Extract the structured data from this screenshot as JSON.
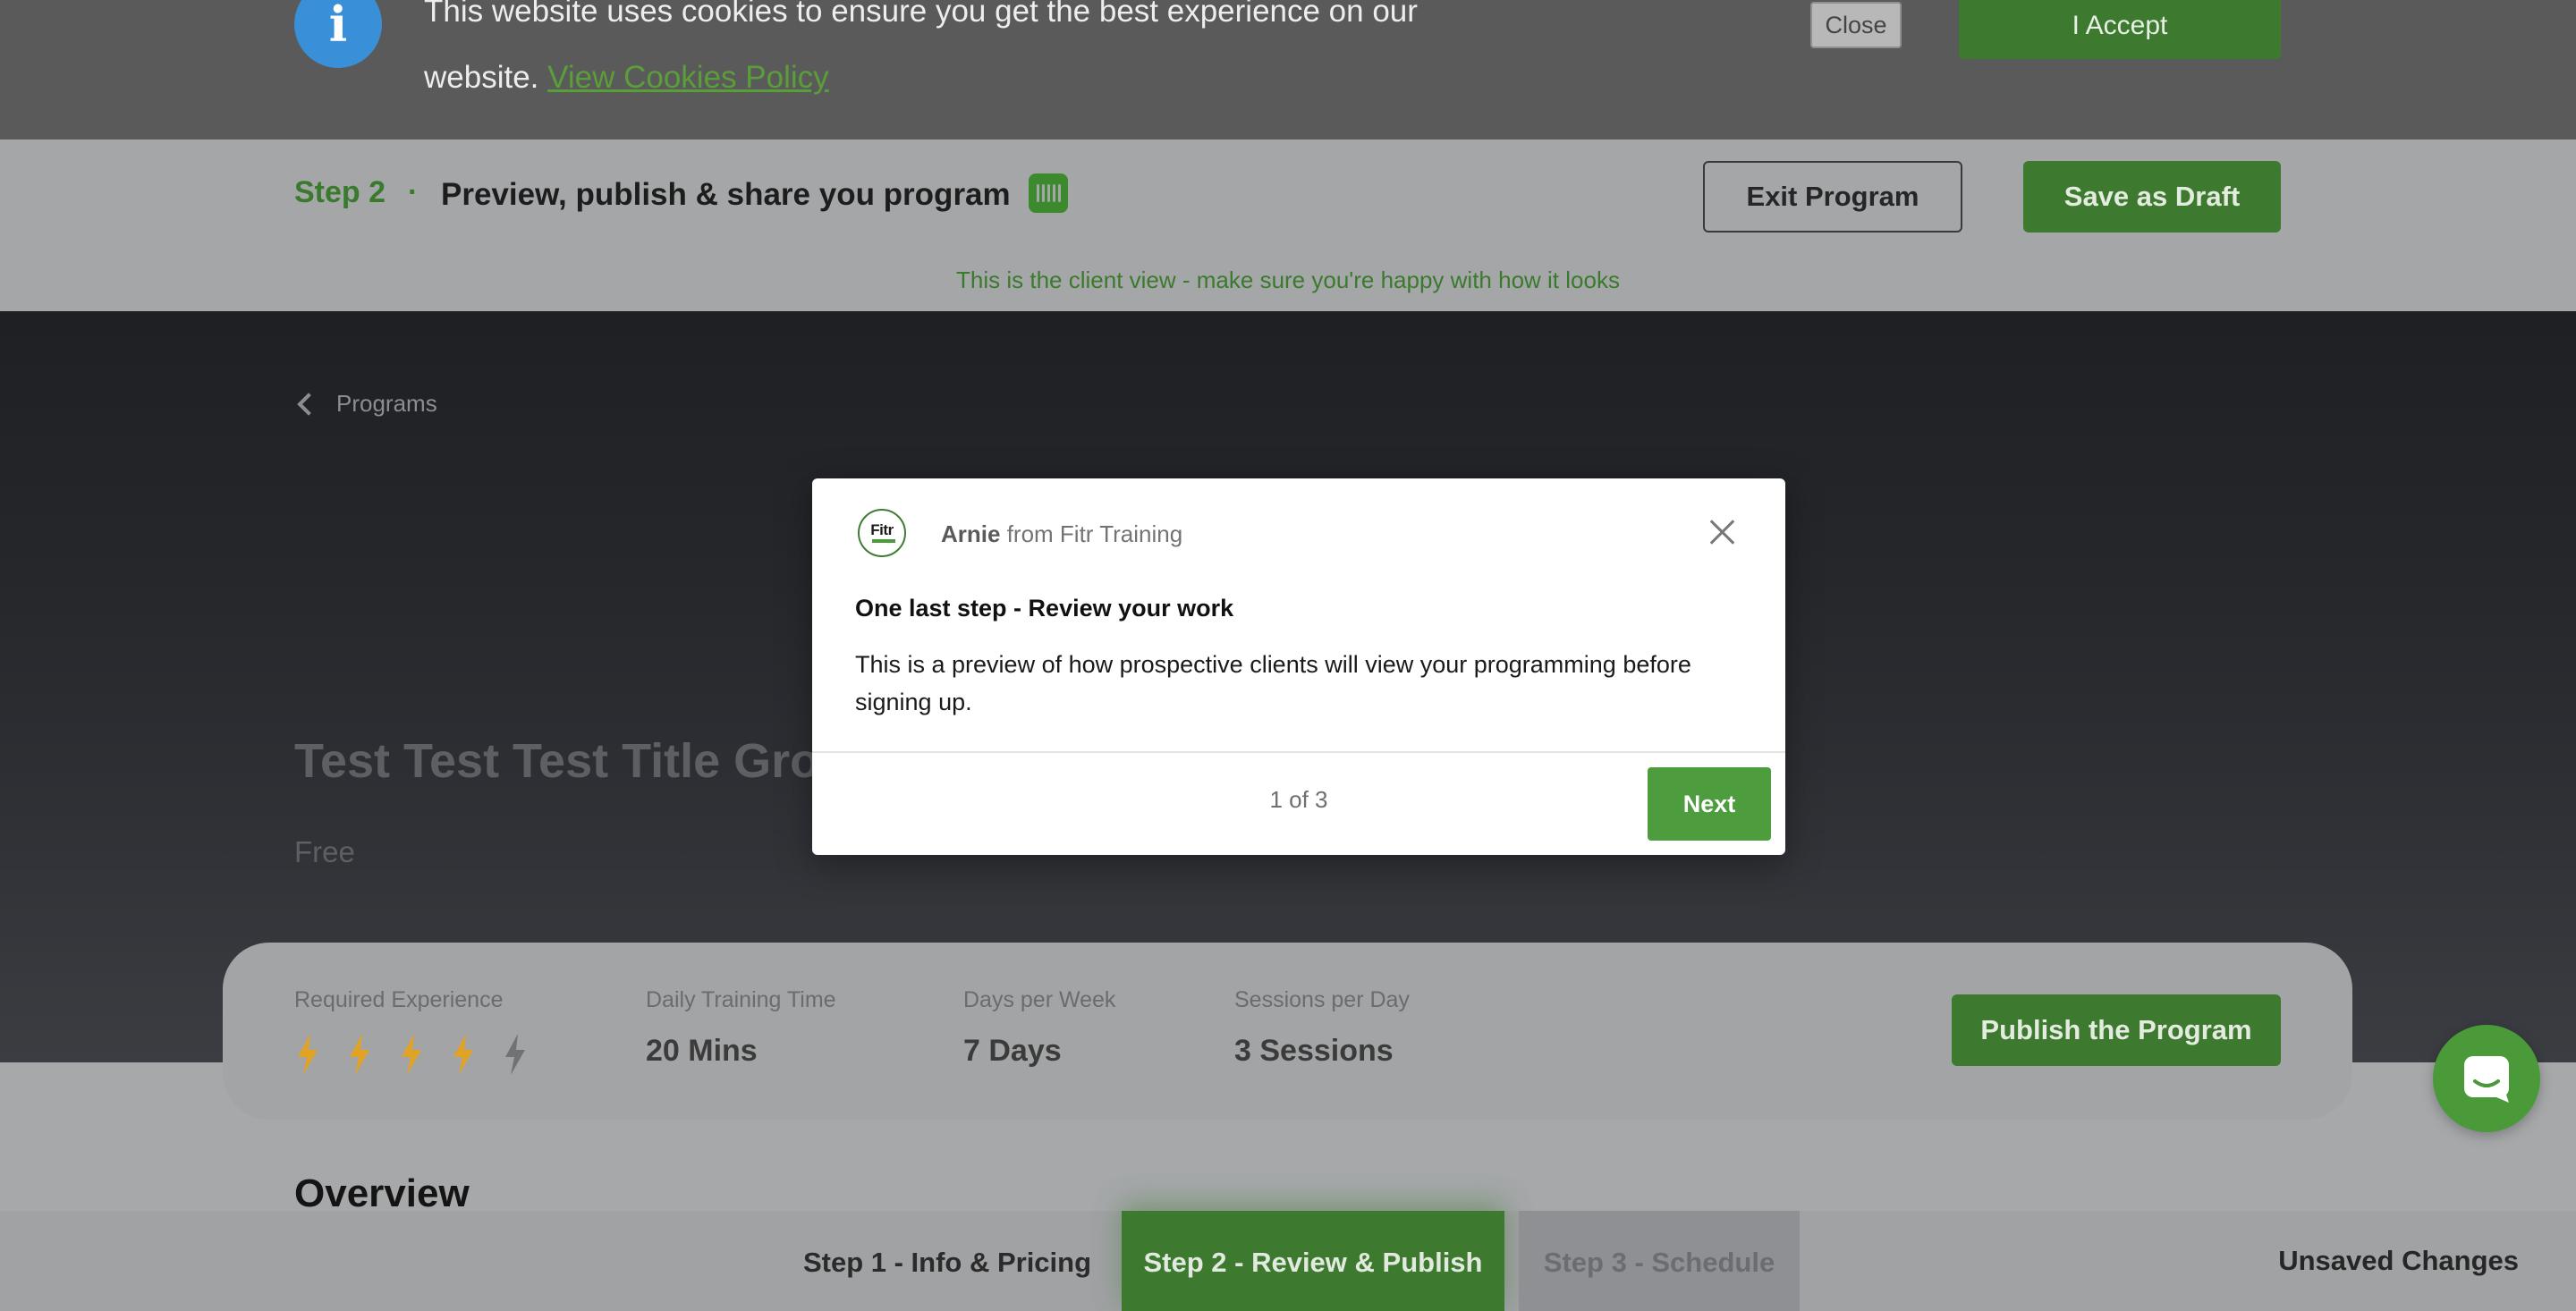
{
  "cookie_banner": {
    "text": "This website uses cookies to ensure you get the best experience on our website.",
    "link_label": "View Cookies Policy",
    "close_label": "Close",
    "accept_label": "I Accept"
  },
  "step_header": {
    "step_label": "Step 2",
    "separator": "·",
    "title": "Preview, publish & share you program",
    "exit_label": "Exit Program",
    "save_draft_label": "Save as Draft",
    "client_view_note": "This is the client view - make sure you're happy with how it looks"
  },
  "hero": {
    "back_label": "Programs",
    "program_title": "Test Test Test Title Grou",
    "price": "Free"
  },
  "stats": {
    "required_experience": {
      "label": "Required Experience",
      "level": 4,
      "max": 5
    },
    "daily_training_time": {
      "label": "Daily Training Time",
      "value": "20 Mins"
    },
    "days_per_week": {
      "label": "Days per Week",
      "value": "7 Days"
    },
    "sessions_per_day": {
      "label": "Sessions per Day",
      "value": "3 Sessions"
    },
    "publish_label": "Publish the Program"
  },
  "overview": {
    "title": "Overview"
  },
  "bottom_nav": {
    "tabs": [
      {
        "label": "Step 1 - Info & Pricing",
        "state": "default"
      },
      {
        "label": "Step 2 - Review & Publish",
        "state": "active"
      },
      {
        "label": "Step 3 - Schedule",
        "state": "disabled"
      }
    ],
    "status": "Unsaved Changes"
  },
  "tour_modal": {
    "avatar_text": "Fitr",
    "sender_name": "Arnie",
    "sender_org": "from Fitr Training",
    "heading": "One last step - Review your work",
    "body": "This is a preview of how prospective clients will view your programming before signing up.",
    "counter": "1 of 3",
    "next_label": "Next"
  },
  "colors": {
    "brand_green": "#3d7a30",
    "accent_green": "#4d9c3d",
    "bolt_active": "#e0a325",
    "bolt_inactive": "#707274",
    "info_blue": "#3a8fd9"
  },
  "icons": {
    "info": "info-icon",
    "back": "chevron-left-icon",
    "intercom_mini": "intercom-icon",
    "bolt": "lightning-bolt-icon",
    "close": "close-icon",
    "launcher": "chat-icon"
  }
}
